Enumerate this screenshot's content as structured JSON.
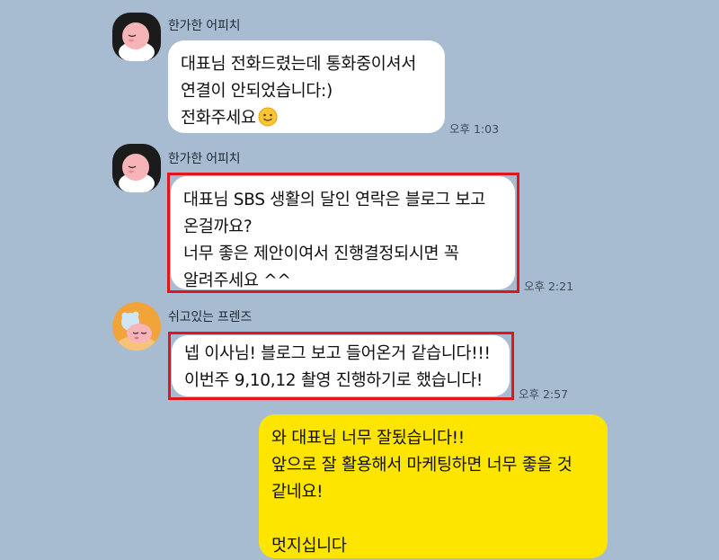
{
  "messages": [
    {
      "sender": "한가한 어피치",
      "lines": [
        "대표님 전화드렸는데 통화중이셔서",
        "연결이 안되었습니다:)",
        "전화주세요"
      ],
      "emoji": "smile-emoji",
      "time": "오후 1:03"
    },
    {
      "sender": "한가한 어피치",
      "lines": [
        "대표님 SBS 생활의 달인 연락은 블로그 보고",
        "온걸까요?",
        "너무 좋은 제안이여서 진행결정되시면 꼭",
        "알려주세요 ^^"
      ],
      "time": "오후 2:21",
      "highlighted": true
    },
    {
      "sender": "쉬고있는 프렌즈",
      "lines": [
        "넵 이사님! 블로그 보고 들어온거 같습니다!!!",
        "이번주 9,10,12 촬영 진행하기로 했습니다!"
      ],
      "time": "오후 2:57",
      "highlighted": true
    },
    {
      "lines": [
        "와 대표님 너무 잘됬습니다!!",
        "앞으로 잘 활용해서 마케팅하면 너무 좋을 것",
        "같네요!",
        "",
        "멋지십니다"
      ],
      "mine": true
    }
  ],
  "colors": {
    "background": "#a7bcd0",
    "my_bubble": "#fee500",
    "other_bubble": "#ffffff",
    "highlight": "#e0161c"
  }
}
